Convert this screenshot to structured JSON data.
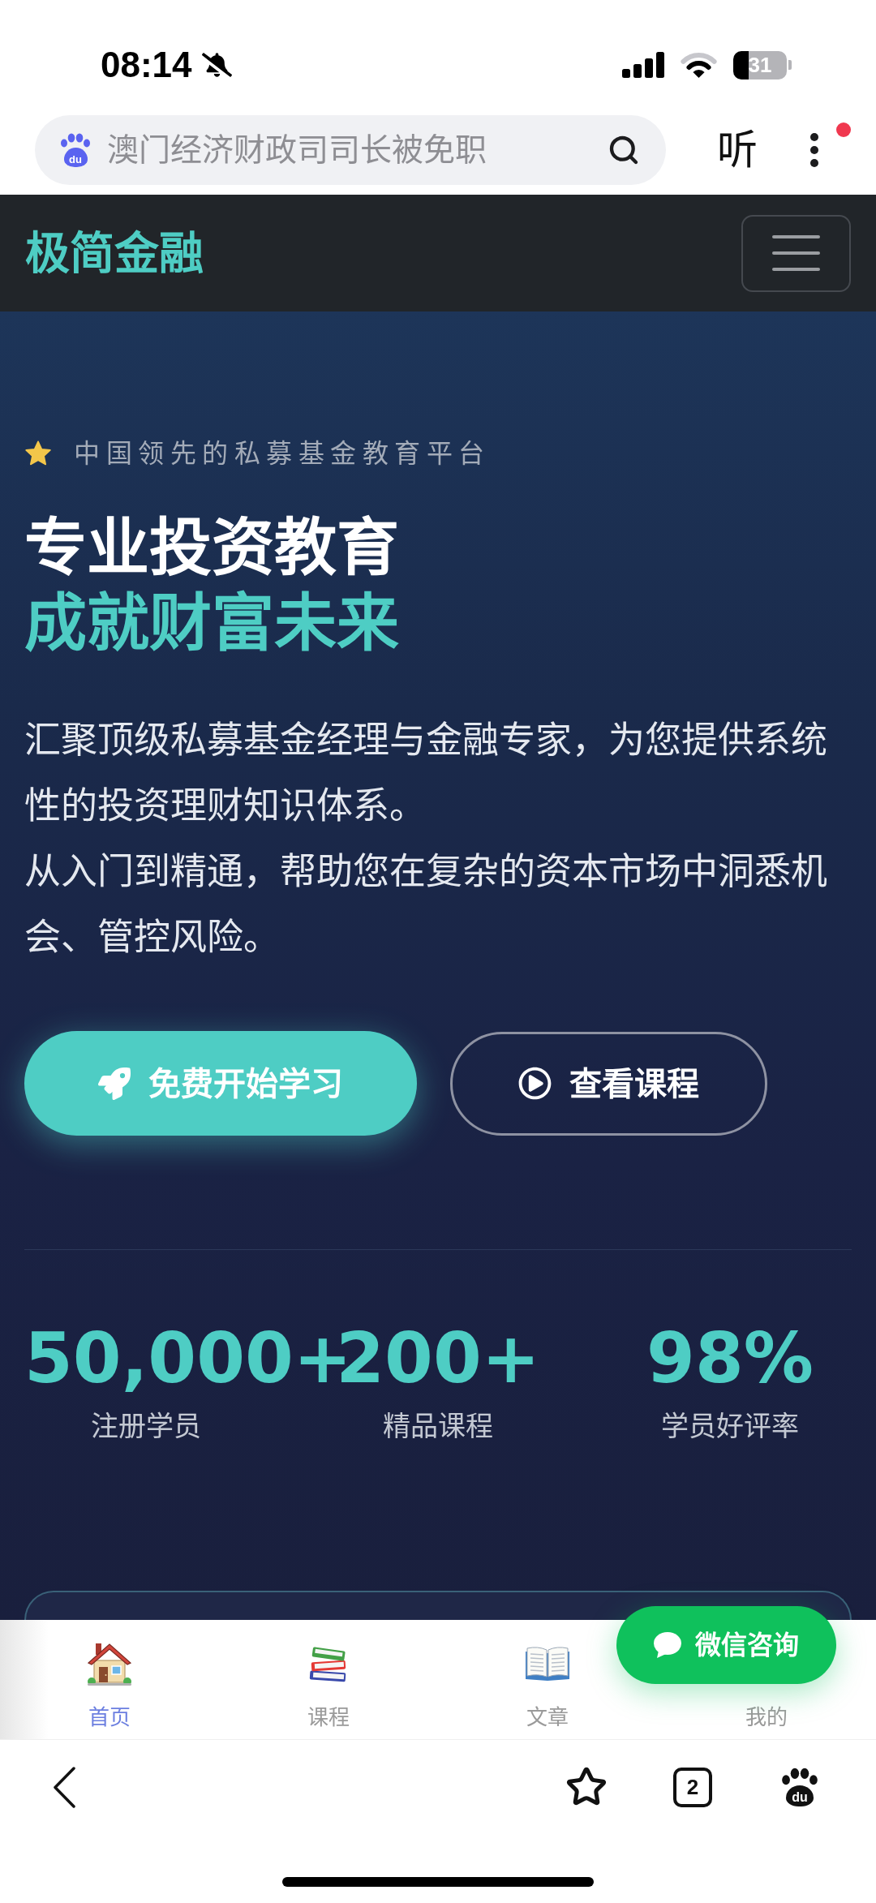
{
  "status_bar": {
    "time": "08:14",
    "battery": "31"
  },
  "browser_bar": {
    "search": {
      "logo_text": "du",
      "placeholder": "澳门经济财政司司长被免职"
    },
    "listen_button": "听",
    "notification_dot": true
  },
  "site_header": {
    "logo": "极简金融"
  },
  "hero": {
    "tagline": "中国领先的私募基金教育平台",
    "title": [
      {
        "text": "专业投资教育",
        "highlight": false
      },
      {
        "text": "成就财富未来",
        "highlight": true
      }
    ],
    "description": [
      "汇聚顶级私募基金经理与金融专家，为您提供系统性的投资理财知识体系。",
      "从入门到精通，帮助您在复杂的资本市场中洞悉机会、管控风险。"
    ],
    "buttons": [
      {
        "label": "免费开始学习",
        "kind": "primary"
      },
      {
        "label": "查看课程",
        "kind": "outline"
      }
    ],
    "stats": [
      {
        "value": "50,000+",
        "label": "注册学员"
      },
      {
        "value": "200+",
        "label": "精品课程"
      },
      {
        "value": "98%",
        "label": "学员好评率"
      }
    ]
  },
  "bottom_nav": [
    {
      "label": "首页",
      "selected": true
    },
    {
      "label": "课程",
      "selected": false
    },
    {
      "label": "文章",
      "selected": false
    },
    {
      "label": "我的",
      "selected": false
    }
  ],
  "chat_button": "微信咨询",
  "browser_toolbar": {
    "tab_count": "2",
    "logo_text": "du"
  }
}
